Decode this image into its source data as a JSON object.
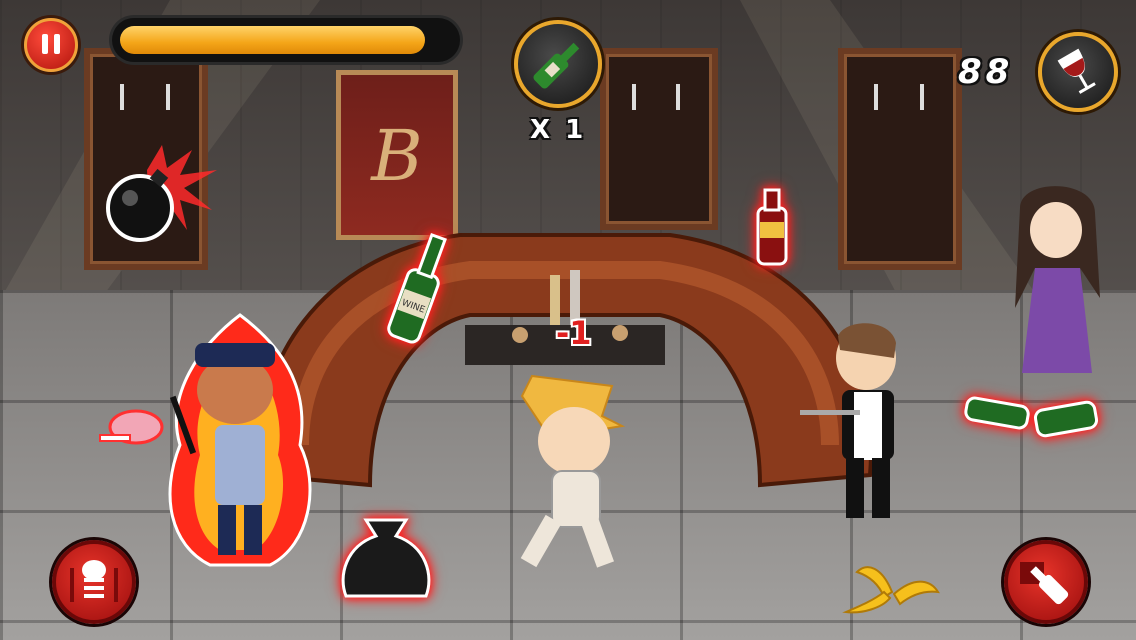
{
  "hud": {
    "progress_fraction": 0.92,
    "bottle_count": "X 1",
    "score": "88"
  },
  "floating": {
    "penalty": "-1",
    "wine_label": "WINE"
  },
  "decor": {
    "monogram": "B"
  },
  "colors": {
    "accent_orange": "#f4a518",
    "hud_red": "#c8150e",
    "gold_ring": "#e9a72c"
  },
  "icons": {
    "pause": "pause-icon",
    "bottle": "green-bottle-icon",
    "glass": "wine-glass-icon",
    "left_button": "cloche-food-icon",
    "right_button": "bottle-throw-icon"
  }
}
